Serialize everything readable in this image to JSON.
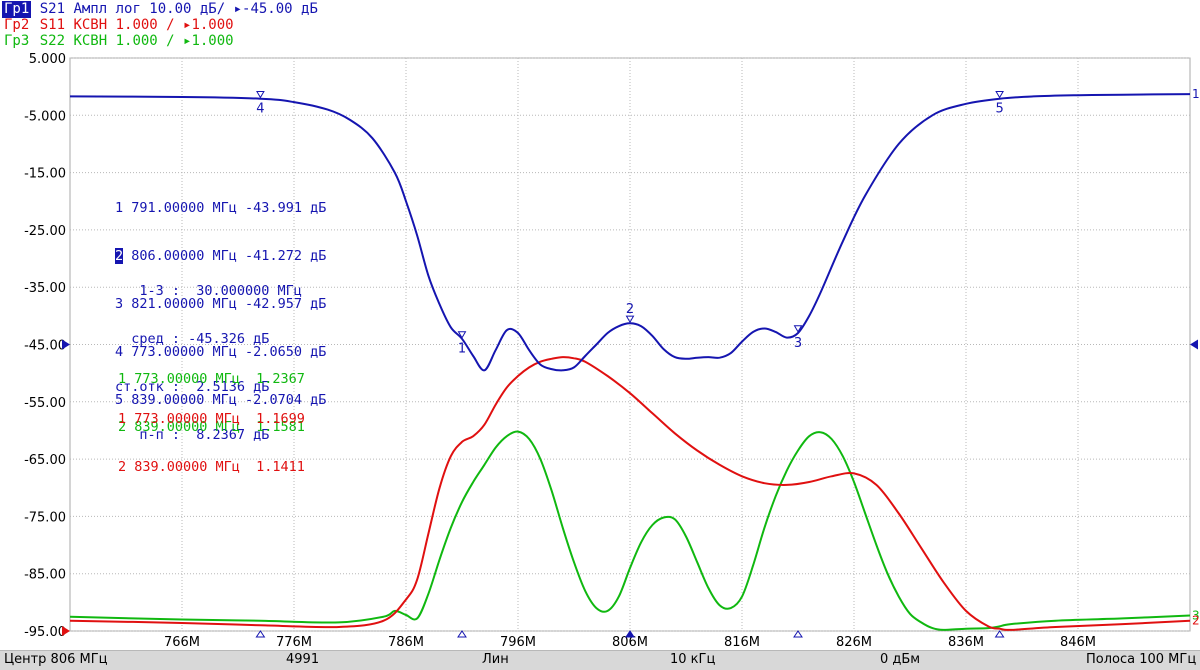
{
  "header": {
    "trace1": {
      "tag": "Гр1",
      "text": " S21 Ампл лог 10.00 дБ/ ▸-45.00 дБ"
    },
    "trace2": {
      "tag": "Гр2",
      "text": " S11 КСВН 1.000 / ▸1.000"
    },
    "trace3": {
      "tag": "Гр3",
      "text": " S22 КСВН 1.000 / ▸1.000"
    }
  },
  "markers_s21": [
    {
      "num": "1",
      "text": " 791.00000 МГц -43.991 дБ"
    },
    {
      "num": "2",
      "text": " 806.00000 МГц -41.272 дБ"
    },
    {
      "num": "3",
      "text": " 821.00000 МГц -42.957 дБ"
    },
    {
      "num": "4",
      "text": " 773.00000 МГц -2.0650 дБ"
    },
    {
      "num": "5",
      "text": " 839.00000 МГц -2.0704 дБ"
    }
  ],
  "stats": [
    "   1-3 :  30.000000 МГц",
    "  сред : -45.326 дБ",
    "ст.отк :  2.5136 дБ",
    "   п-п :  8.2367 дБ"
  ],
  "markers_s22": [
    "1 773.00000 МГц  1.2367",
    "2 839.00000 МГц  1.1581"
  ],
  "markers_s11": [
    "1 773.00000 МГц  1.1699",
    "2 839.00000 МГц  1.1411"
  ],
  "status": {
    "center": "Центр 806 МГц",
    "points": "4991",
    "sweep": "Лин",
    "ifbw": "10 кГц",
    "power": "0 дБм",
    "span": "Полоса 100 МГц"
  },
  "chart_data": {
    "type": "line",
    "title": "",
    "xlabel": "",
    "ylabel": "",
    "xlim": [
      756,
      856
    ],
    "ylim": [
      -95,
      5
    ],
    "x_ticks": [
      766,
      776,
      786,
      796,
      806,
      816,
      826,
      836,
      846
    ],
    "x_tick_labels": [
      "766M",
      "776M",
      "786M",
      "796M",
      "806M",
      "816M",
      "826M",
      "836M",
      "846M"
    ],
    "y_ticks": [
      5,
      -5,
      -15,
      -25,
      -35,
      -45,
      -55,
      -65,
      -75,
      -85,
      -95
    ],
    "y_tick_labels": [
      "5.000",
      "-5.000",
      "-15.00",
      "-25.00",
      "-35.00",
      "-45.00",
      "-55.00",
      "-65.00",
      "-75.00",
      "-85.00",
      "-95.00"
    ],
    "grid": true,
    "colors": {
      "S21": "#1515b0",
      "S11": "#e01010",
      "S22": "#10b810"
    },
    "series": [
      {
        "name": "S21",
        "x": [
          756,
          766,
          773,
          776,
          779,
          781,
          783,
          785,
          786,
          787,
          788,
          789,
          790,
          791,
          792,
          793,
          794,
          795,
          796,
          797,
          798,
          799,
          800,
          801,
          802,
          803,
          804,
          805,
          806,
          807,
          808,
          809,
          810,
          811,
          812,
          813,
          814,
          815,
          816,
          817,
          818,
          819,
          820,
          821,
          822,
          823,
          825,
          827,
          830,
          833,
          836,
          839,
          842,
          846,
          850,
          856
        ],
        "y": [
          -1.7,
          -1.8,
          -2.1,
          -2.7,
          -4.0,
          -5.8,
          -9.0,
          -15,
          -20,
          -26,
          -33,
          -38,
          -42,
          -44,
          -47,
          -49.5,
          -46,
          -42.5,
          -43,
          -46,
          -48.5,
          -49.3,
          -49.5,
          -49,
          -47,
          -45,
          -43,
          -41.8,
          -41.3,
          -41.8,
          -43.5,
          -45.8,
          -47.2,
          -47.5,
          -47.3,
          -47.2,
          -47.3,
          -46.5,
          -44.5,
          -42.8,
          -42.2,
          -42.8,
          -43.8,
          -43,
          -40,
          -36,
          -27,
          -19,
          -10,
          -5,
          -3,
          -2.1,
          -1.7,
          -1.5,
          -1.4,
          -1.3
        ]
      },
      {
        "name": "S11",
        "x": [
          756,
          766,
          773,
          780,
          784,
          786,
          787,
          788,
          789,
          790,
          791,
          792,
          793,
          794,
          795,
          796,
          797,
          798,
          799,
          800,
          801,
          802,
          804,
          806,
          808,
          810,
          812,
          814,
          816,
          818,
          820,
          822,
          824,
          826,
          828,
          830,
          832,
          834,
          836,
          838,
          839,
          840,
          844,
          850,
          856
        ],
        "y": [
          -93.2,
          -93.6,
          -94.0,
          -94.3,
          -93.2,
          -89.5,
          -86,
          -78,
          -70,
          -64.5,
          -62,
          -61,
          -59,
          -55.5,
          -52.5,
          -50.5,
          -49,
          -48,
          -47.5,
          -47.2,
          -47.4,
          -48,
          -50.5,
          -53.5,
          -57,
          -60.5,
          -63.5,
          -66,
          -68,
          -69.2,
          -69.5,
          -69,
          -68,
          -67.5,
          -69.5,
          -74.5,
          -80.5,
          -86.5,
          -91.5,
          -94.2,
          -94.6,
          -94.8,
          -94.3,
          -93.8,
          -93.2
        ]
      },
      {
        "name": "S22",
        "x": [
          756,
          766,
          773,
          780,
          784,
          785,
          786,
          787,
          788,
          789,
          790,
          791,
          792,
          793,
          794,
          795,
          796,
          797,
          798,
          799,
          800,
          801,
          802,
          803,
          804,
          805,
          806,
          807,
          808,
          809,
          810,
          811,
          812,
          813,
          814,
          815,
          816,
          817,
          818,
          819,
          820,
          821,
          822,
          823,
          824,
          825,
          826,
          827,
          828,
          829,
          830,
          831,
          832,
          833,
          834,
          836,
          838,
          839,
          840,
          844,
          850,
          856
        ],
        "y": [
          -92.5,
          -93,
          -93.2,
          -93.5,
          -92.5,
          -91.5,
          -92.2,
          -92.8,
          -88.5,
          -82.5,
          -77,
          -72.5,
          -69,
          -66,
          -63,
          -61,
          -60.2,
          -61.5,
          -65,
          -70.5,
          -77,
          -83,
          -88,
          -91,
          -91.5,
          -89,
          -84,
          -79.5,
          -76.5,
          -75.2,
          -75.5,
          -78.5,
          -83,
          -87.5,
          -90.5,
          -91,
          -89,
          -83.5,
          -77,
          -71.5,
          -67,
          -63.5,
          -61,
          -60.3,
          -61.5,
          -64.5,
          -69,
          -74.5,
          -80,
          -85,
          -89,
          -92,
          -93.5,
          -94.5,
          -94.8,
          -94.6,
          -94.5,
          -94.2,
          -93.8,
          -93.2,
          -92.8,
          -92.3
        ]
      }
    ],
    "markers": [
      {
        "series": "S21",
        "label": "1",
        "x": 791,
        "y": -43.991
      },
      {
        "series": "S21",
        "label": "2",
        "x": 806,
        "y": -41.272
      },
      {
        "series": "S21",
        "label": "3",
        "x": 821,
        "y": -42.957
      },
      {
        "series": "S21",
        "label": "4",
        "x": 773,
        "y": -2.065
      },
      {
        "series": "S21",
        "label": "5",
        "x": 839,
        "y": -2.0704
      }
    ],
    "right_edge_labels": {
      "S21": "1",
      "S11": "2",
      "S22": "3"
    }
  }
}
